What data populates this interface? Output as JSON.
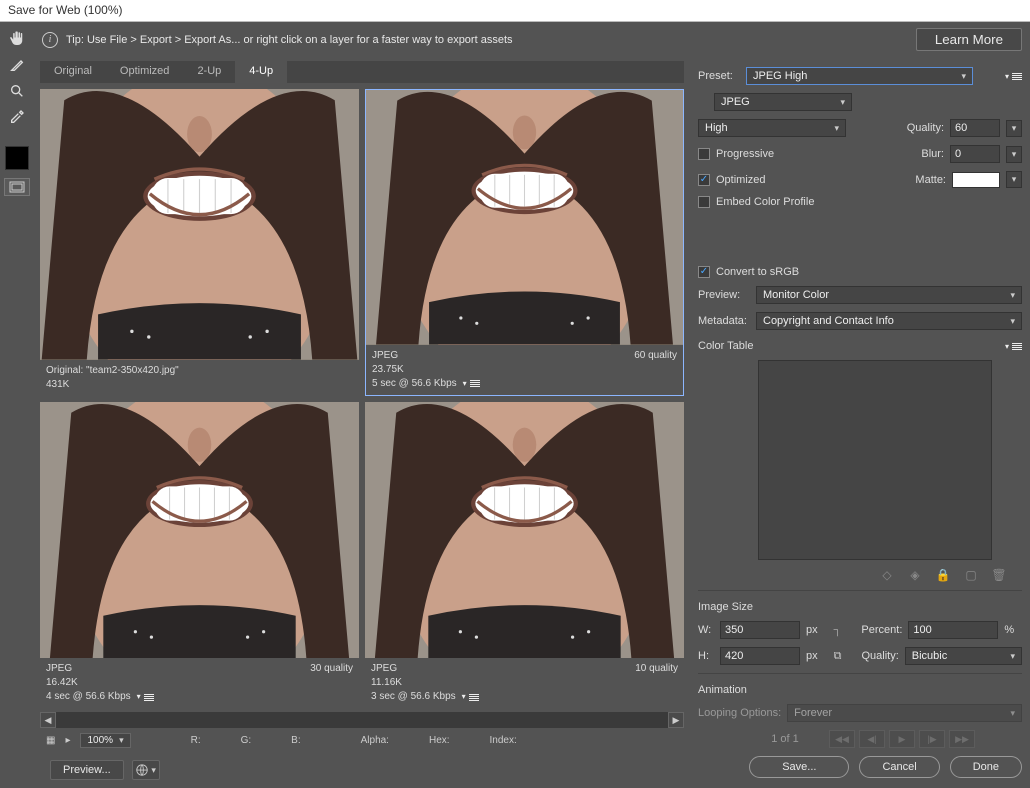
{
  "title": "Save for Web (100%)",
  "tip": {
    "text": "Tip: Use File > Export > Export As...  or right click on a layer for a faster way to export assets",
    "learn_more": "Learn More"
  },
  "tabs": [
    "Original",
    "Optimized",
    "2-Up",
    "4-Up"
  ],
  "active_tab": 3,
  "previews": [
    {
      "title": "Original: \"team2-350x420.jpg\"",
      "size": "431K",
      "speed": "",
      "right": ""
    },
    {
      "title": "JPEG",
      "size": "23.75K",
      "speed": "5 sec @ 56.6 Kbps",
      "right": "60 quality",
      "selected": true
    },
    {
      "title": "JPEG",
      "size": "16.42K",
      "speed": "4 sec @ 56.6 Kbps",
      "right": "30 quality"
    },
    {
      "title": "JPEG",
      "size": "11.16K",
      "speed": "3 sec @ 56.6 Kbps",
      "right": "10 quality"
    }
  ],
  "zoom": "100%",
  "status": {
    "r": "R:",
    "g": "G:",
    "b": "B:",
    "alpha": "Alpha:",
    "hex": "Hex:",
    "index": "Index:"
  },
  "preset": {
    "label": "Preset:",
    "value": "JPEG High"
  },
  "format": "JPEG",
  "quality_level": "High",
  "quality": {
    "label": "Quality:",
    "value": "60"
  },
  "progressive": {
    "label": "Progressive",
    "checked": false
  },
  "blur": {
    "label": "Blur:",
    "value": "0"
  },
  "optimized": {
    "label": "Optimized",
    "checked": true
  },
  "matte": {
    "label": "Matte:"
  },
  "embed_profile": {
    "label": "Embed Color Profile",
    "checked": false
  },
  "convert_srgb": {
    "label": "Convert to sRGB",
    "checked": true
  },
  "preview_mode": {
    "label": "Preview:",
    "value": "Monitor Color"
  },
  "metadata": {
    "label": "Metadata:",
    "value": "Copyright and Contact Info"
  },
  "color_table": "Color Table",
  "image_size": {
    "title": "Image Size",
    "w_label": "W:",
    "w": "350",
    "px": "px",
    "h_label": "H:",
    "h": "420",
    "percent_label": "Percent:",
    "percent": "100",
    "percent_unit": "%",
    "quality_label": "Quality:",
    "quality": "Bicubic"
  },
  "animation": {
    "title": "Animation",
    "looping_label": "Looping Options:",
    "looping": "Forever",
    "frame": "1 of 1"
  },
  "buttons": {
    "preview": "Preview...",
    "save": "Save...",
    "cancel": "Cancel",
    "done": "Done"
  }
}
